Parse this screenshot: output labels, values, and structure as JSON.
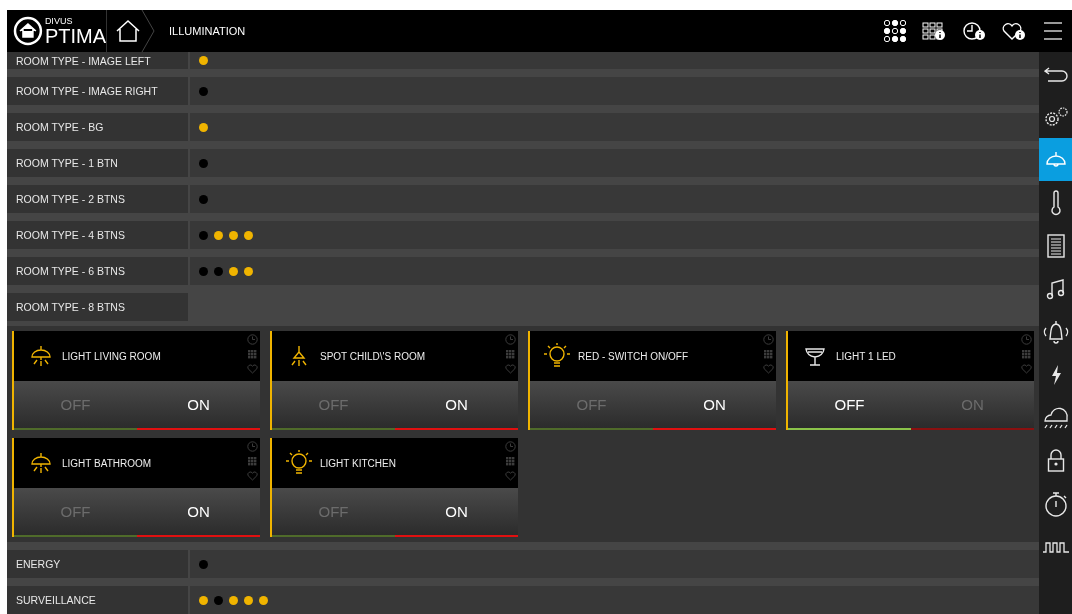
{
  "header": {
    "logo": {
      "brand": "DIVUS",
      "wordmark": "PTIMA"
    },
    "breadcrumb": "ILLUMINATION"
  },
  "sidebar": {
    "items": [
      {
        "kind": "back",
        "selected": false
      },
      {
        "kind": "gears",
        "selected": false
      },
      {
        "kind": "lamp",
        "selected": true
      },
      {
        "kind": "thermometer",
        "selected": false
      },
      {
        "kind": "shutter",
        "selected": false
      },
      {
        "kind": "music",
        "selected": false
      },
      {
        "kind": "alarm",
        "selected": false
      },
      {
        "kind": "energy",
        "selected": false
      },
      {
        "kind": "weather",
        "selected": false
      },
      {
        "kind": "lock",
        "selected": false
      },
      {
        "kind": "timer",
        "selected": false
      },
      {
        "kind": "pulse",
        "selected": false
      }
    ]
  },
  "rows": [
    {
      "kind": "indicators",
      "label": "ROOM TYPE - IMAGE LEFT",
      "indicators": [
        {
          "on": true
        }
      ]
    },
    {
      "kind": "indicators",
      "label": "ROOM TYPE - IMAGE RIGHT",
      "indicators": [
        {
          "on": false
        }
      ]
    },
    {
      "kind": "indicators",
      "label": "ROOM TYPE - BG",
      "indicators": [
        {
          "on": true
        }
      ]
    },
    {
      "kind": "indicators",
      "label": "ROOM TYPE - 1 BTN",
      "indicators": [
        {
          "on": false
        }
      ]
    },
    {
      "kind": "indicators",
      "label": "ROOM TYPE - 2 BTNS",
      "indicators": [
        {
          "on": false
        }
      ]
    },
    {
      "kind": "indicators",
      "label": "ROOM TYPE - 4 BTNS",
      "indicators": [
        {
          "on": false
        },
        {
          "on": true
        },
        {
          "on": true
        },
        {
          "on": true
        }
      ]
    },
    {
      "kind": "indicators",
      "label": "ROOM TYPE - 6 BTNS",
      "indicators": [
        {
          "on": false
        },
        {
          "on": false
        },
        {
          "on": true
        },
        {
          "on": true
        }
      ]
    },
    {
      "kind": "widgets",
      "label": "ROOM TYPE - 8 BTNS",
      "widgets": [
        {
          "name": "LIGHT LIVING ROOM",
          "kind": "ceiling-lamp",
          "on": true,
          "off_label": "OFF",
          "on_label": "ON"
        },
        {
          "name": "SPOT CHILD\\'S ROOM",
          "kind": "spot",
          "on": true,
          "off_label": "OFF",
          "on_label": "ON"
        },
        {
          "name": "RED - SWITCH ON/OFF",
          "kind": "bulb",
          "on": true,
          "off_label": "OFF",
          "on_label": "ON"
        },
        {
          "name": "LIGHT 1 LED",
          "kind": "glass",
          "on": false,
          "off_label": "OFF",
          "on_label": "ON"
        },
        {
          "name": "LIGHT BATHROOM",
          "kind": "ceiling-lamp",
          "on": true,
          "off_label": "OFF",
          "on_label": "ON"
        },
        {
          "name": "LIGHT KITCHEN",
          "kind": "bulb",
          "on": true,
          "off_label": "OFF",
          "on_label": "ON"
        }
      ]
    },
    {
      "kind": "indicators",
      "label": "ENERGY",
      "indicators": [
        {
          "on": false
        }
      ]
    },
    {
      "kind": "indicators",
      "label": "SURVEILLANCE",
      "indicators": [
        {
          "on": true
        },
        {
          "on": false
        },
        {
          "on": true
        },
        {
          "on": true
        },
        {
          "on": true
        }
      ]
    }
  ]
}
